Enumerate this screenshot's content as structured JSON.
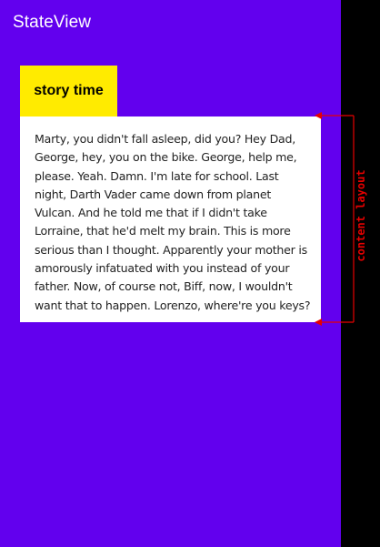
{
  "app": {
    "title": "StateView",
    "background_color": "#6200EE",
    "side_color": "#000000"
  },
  "tab": {
    "label": "story time",
    "color": "#FFEB00"
  },
  "content": {
    "text": "Marty, you didn't fall asleep, did you? Hey Dad, George, hey, you on the bike. George, help me, please. Yeah. Damn. I'm late for school. Last night, Darth Vader came down from planet Vulcan. And he told me that if I didn't take Lorraine, that he'd melt my brain. This is more serious than I thought. Apparently your mother is amorously infatuated with you instead of your father. Now, of course not, Biff, now, I wouldn't want that to happen. Lorenzo, where're you keys?"
  },
  "annotation": {
    "label": "content layout",
    "color": "#E50000"
  }
}
